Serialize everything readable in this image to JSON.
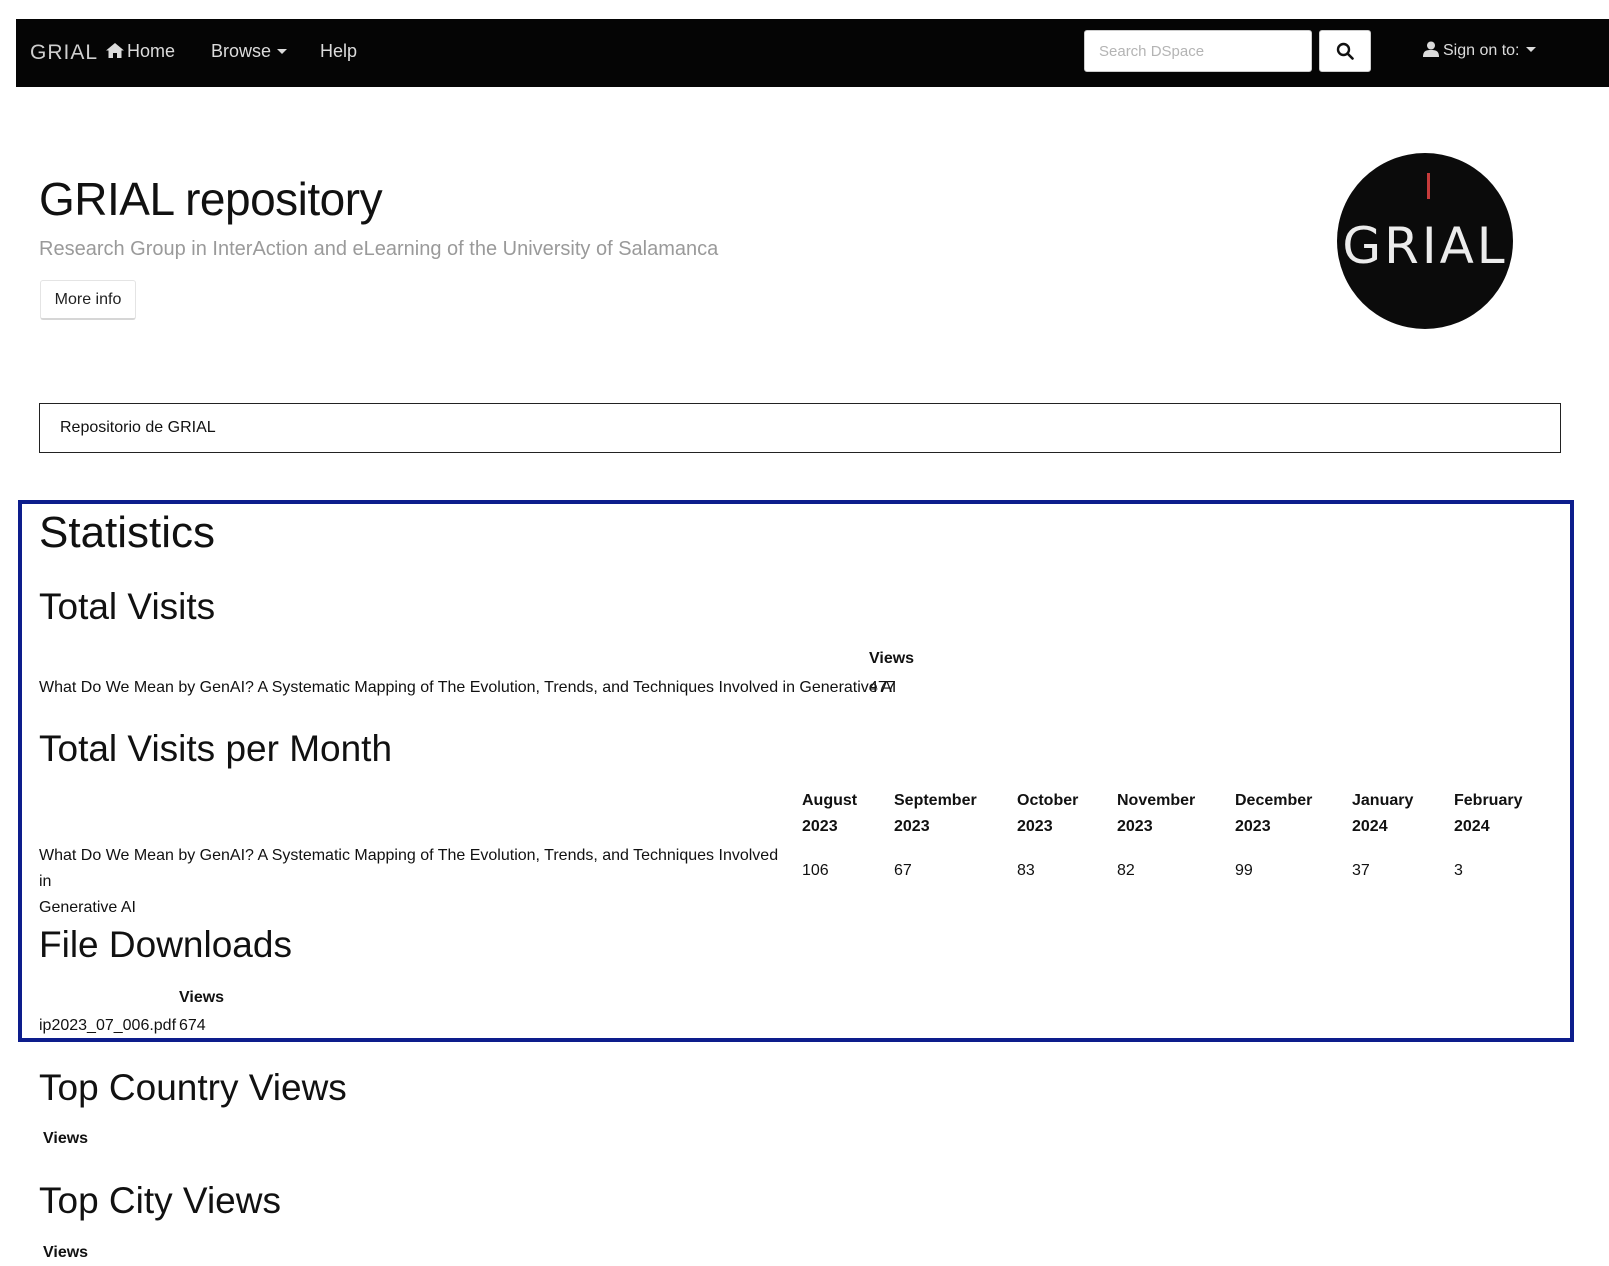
{
  "navbar": {
    "brand": "GRIAL",
    "home_label": "Home",
    "browse_label": "Browse",
    "help_label": "Help",
    "search_placeholder": "Search DSpace",
    "signin_label": "Sign on to:"
  },
  "header": {
    "title": "GRIAL repository",
    "subtitle": "Research Group in InterAction and eLearning of the University of Salamanca",
    "more_info_label": "More info",
    "logo_text": "GRIAL"
  },
  "breadcrumb": {
    "item": "Repositorio de GRIAL"
  },
  "statistics": {
    "title": "Statistics",
    "total_visits": {
      "title": "Total Visits",
      "column_header": "Views",
      "row_title": "What Do We Mean by GenAI? A Systematic Mapping of The Evolution, Trends, and Techniques Involved in Generative AI",
      "row_value": "477"
    },
    "per_month": {
      "title": "Total Visits per Month",
      "columns": [
        {
          "month": "August",
          "year": "2023",
          "value": "106"
        },
        {
          "month": "September",
          "year": "2023",
          "value": "67"
        },
        {
          "month": "October",
          "year": "2023",
          "value": "83"
        },
        {
          "month": "November",
          "year": "2023",
          "value": "82"
        },
        {
          "month": "December",
          "year": "2023",
          "value": "99"
        },
        {
          "month": "January",
          "year": "2024",
          "value": "37"
        },
        {
          "month": "February",
          "year": "2024",
          "value": "3"
        }
      ],
      "row_title_line1": "What Do We Mean by GenAI? A Systematic Mapping of The Evolution, Trends, and Techniques Involved in",
      "row_title_line2": "Generative AI"
    },
    "file_downloads": {
      "title": "File Downloads",
      "column_header": "Views",
      "file_name": "ip2023_07_006.pdf",
      "value": "674"
    },
    "top_country": {
      "title": "Top Country Views",
      "column_header": "Views"
    },
    "top_city": {
      "title": "Top City Views",
      "column_header": "Views"
    }
  }
}
